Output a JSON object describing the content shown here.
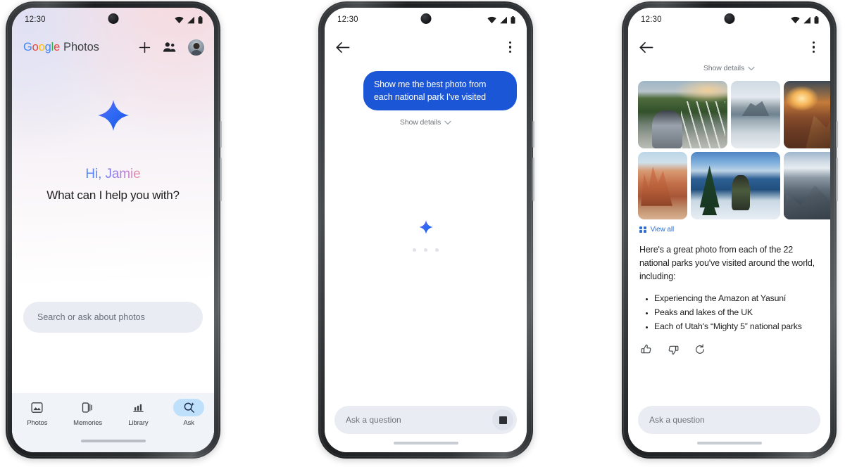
{
  "meta": {
    "accent_blue": "#1a56d6",
    "link_blue": "#2f6fd0",
    "nav_active": "#bfe0fb"
  },
  "phone1": {
    "status": {
      "time": "12:30",
      "icons": [
        "wifi-icon",
        "cellular-signal-icon",
        "battery-icon"
      ]
    },
    "header": {
      "logo_g1": "G",
      "logo_o1": "o",
      "logo_o2": "o",
      "logo_g2": "g",
      "logo_l": "l",
      "logo_e": "e",
      "app_word": "Photos",
      "add_label": "+",
      "sharing_icon": "people-icon",
      "avatar_icon": "account-avatar"
    },
    "hero": {
      "sparkle_icon": "gemini-sparkle-icon",
      "greeting": "Hi, Jamie",
      "prompt": "What can I help you with?"
    },
    "search": {
      "placeholder": "Search or ask about photos"
    },
    "nav": [
      {
        "label": "Photos",
        "icon": "photos-icon",
        "active": false
      },
      {
        "label": "Memories",
        "icon": "memories-icon",
        "active": false
      },
      {
        "label": "Library",
        "icon": "library-icon",
        "active": false
      },
      {
        "label": "Ask",
        "icon": "ask-search-sparkle-icon",
        "active": true
      }
    ]
  },
  "phone2": {
    "status": {
      "time": "12:30"
    },
    "appbar": {
      "back_icon": "back-arrow-icon",
      "menu_icon": "overflow-menu-icon"
    },
    "message": {
      "text": "Show me the best photo from each national park I've visited"
    },
    "show_details": {
      "label": "Show details",
      "chevron": "chevron-down-icon"
    },
    "loading": {
      "sparkle_icon": "gemini-sparkle-icon",
      "dots": 3
    },
    "askbar": {
      "placeholder": "Ask a question",
      "stop_icon": "stop-generating-icon"
    }
  },
  "phone3": {
    "status": {
      "time": "12:30"
    },
    "appbar": {
      "back_icon": "back-arrow-icon",
      "menu_icon": "overflow-menu-icon"
    },
    "show_details": {
      "label": "Show details",
      "chevron": "chevron-down-icon"
    },
    "photos": [
      {
        "alt": "selfie-on-forest-overlook-boardwalk"
      },
      {
        "alt": "mountain-reflected-in-calm-lake"
      },
      {
        "alt": "sunset-over-red-rock-cliffs"
      },
      {
        "alt": "red-rock-hoodoos-bryce-canyon"
      },
      {
        "alt": "person-standing-at-crater-lake"
      },
      {
        "alt": "glacier-and-snowy-mountain-ridge"
      }
    ],
    "view_all": {
      "label": "View all",
      "icon": "grid-view-icon"
    },
    "answer": {
      "paragraph": "Here's a great photo from each of the 22 national parks you've visited around the world, including:",
      "bullets": [
        "Experiencing the Amazon at Yasuní",
        "Peaks and lakes of the UK",
        "Each of Utah's “Mighty 5” national parks"
      ]
    },
    "actions": [
      {
        "icon": "thumb-up-icon"
      },
      {
        "icon": "thumb-down-icon"
      },
      {
        "icon": "regenerate-refresh-icon"
      }
    ],
    "askbar": {
      "placeholder": "Ask a question"
    }
  }
}
